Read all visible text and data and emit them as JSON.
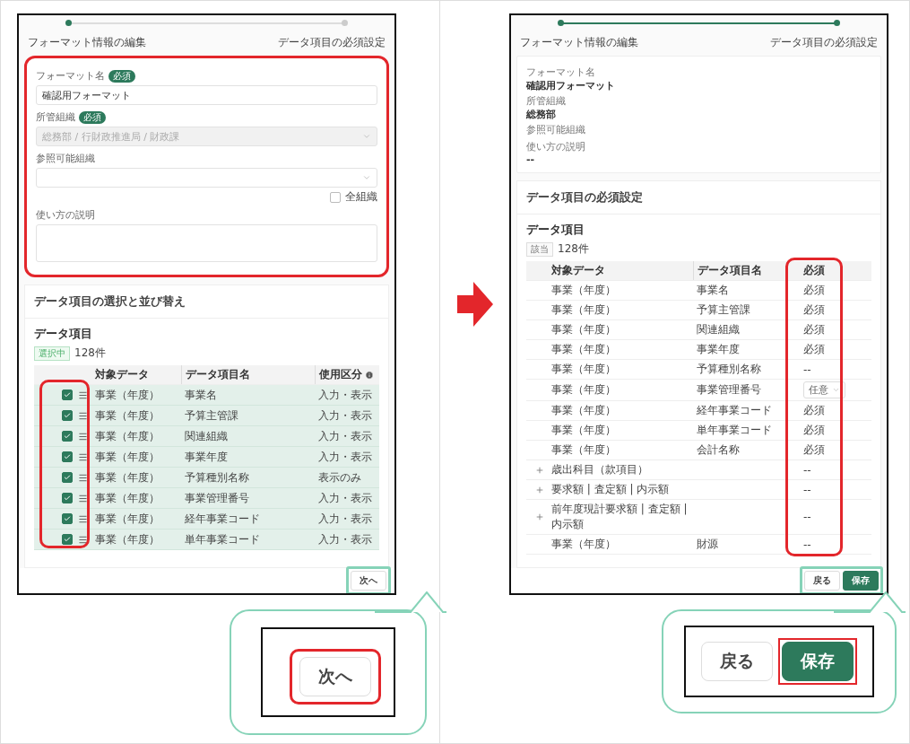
{
  "left_screen": {
    "steps": [
      {
        "label": "フォーマット情報の編集",
        "reached": true
      },
      {
        "label": "データ項目の必須設定",
        "reached": false
      }
    ],
    "form": [
      {
        "kind": "text",
        "label": "フォーマット名",
        "badge": "必須",
        "value": "確認用フォーマット"
      },
      {
        "kind": "select",
        "label": "所管組織",
        "badge": "必須",
        "value": "総務部 / 行財政推進局 / 財政課",
        "disabled": true
      },
      {
        "kind": "select",
        "label": "参照可能組織",
        "disabled": false,
        "option": {
          "label": "全組織",
          "checked": false
        }
      },
      {
        "kind": "textarea",
        "label": "使い方の説明"
      }
    ],
    "section_title": "データ項目の選択と並び替え",
    "list_title": "データ項目",
    "badge": "選択中",
    "count": "128件",
    "columns": [
      "対象データ",
      "データ項目名",
      "使用区分"
    ],
    "rows": [
      {
        "checked": true,
        "target": "事業（年度）",
        "item": "事業名",
        "usage": "入力・表示"
      },
      {
        "checked": true,
        "target": "事業（年度）",
        "item": "予算主管課",
        "usage": "入力・表示"
      },
      {
        "checked": true,
        "target": "事業（年度）",
        "item": "関連組織",
        "usage": "入力・表示"
      },
      {
        "checked": true,
        "target": "事業（年度）",
        "item": "事業年度",
        "usage": "入力・表示"
      },
      {
        "checked": true,
        "target": "事業（年度）",
        "item": "予算種別名称",
        "usage": "表示のみ"
      },
      {
        "checked": true,
        "target": "事業（年度）",
        "item": "事業管理番号",
        "usage": "入力・表示"
      },
      {
        "checked": true,
        "target": "事業（年度）",
        "item": "経年事業コード",
        "usage": "入力・表示"
      },
      {
        "checked": true,
        "target": "事業（年度）",
        "item": "単年事業コード",
        "usage": "入力・表示"
      }
    ],
    "buttons": [
      {
        "label": "次へ",
        "kind": "secondary"
      }
    ]
  },
  "left_callout": {
    "buttons": [
      {
        "label": "次へ",
        "kind": "secondary"
      }
    ]
  },
  "right_screen": {
    "steps": [
      {
        "label": "フォーマット情報の編集",
        "reached": true
      },
      {
        "label": "データ項目の必須設定",
        "reached": true
      }
    ],
    "summary": [
      {
        "label": "フォーマット名",
        "value": "確認用フォーマット"
      },
      {
        "label": "所管組織",
        "value": "総務部"
      },
      {
        "label": "参照可能組織"
      },
      {
        "label": "使い方の説明",
        "value": "--"
      }
    ],
    "section_title": "データ項目の必須設定",
    "list_title": "データ項目",
    "badge": "該当",
    "count": "128件",
    "columns": [
      "対象データ",
      "データ項目名",
      "必須"
    ],
    "rows": [
      {
        "kind": "text",
        "target": "事業（年度）",
        "item": "事業名",
        "required": "必須"
      },
      {
        "kind": "text",
        "target": "事業（年度）",
        "item": "予算主管課",
        "required": "必須"
      },
      {
        "kind": "text",
        "target": "事業（年度）",
        "item": "関連組織",
        "required": "必須"
      },
      {
        "kind": "text",
        "target": "事業（年度）",
        "item": "事業年度",
        "required": "必須"
      },
      {
        "kind": "text",
        "target": "事業（年度）",
        "item": "予算種別名称",
        "required": "--"
      },
      {
        "kind": "select",
        "target": "事業（年度）",
        "item": "事業管理番号",
        "required": "任意"
      },
      {
        "kind": "text",
        "target": "事業（年度）",
        "item": "経年事業コード",
        "required": "必須"
      },
      {
        "kind": "text",
        "target": "事業（年度）",
        "item": "単年事業コード",
        "required": "必須"
      },
      {
        "kind": "text",
        "target": "事業（年度）",
        "item": "会計名称",
        "required": "必須"
      },
      {
        "kind": "group",
        "target": "歳出科目（款項目）",
        "required": "--"
      },
      {
        "kind": "group",
        "target": "要求額 | 査定額 | 内示額",
        "required": "--"
      },
      {
        "kind": "group",
        "target": "前年度現計要求額 | 査定額 | 内示額",
        "required": "--"
      },
      {
        "kind": "text",
        "target": "事業（年度）",
        "item": "財源",
        "required": "--"
      }
    ],
    "buttons": [
      {
        "label": "戻る",
        "kind": "secondary"
      },
      {
        "label": "保存",
        "kind": "primary"
      }
    ]
  },
  "right_callout": {
    "buttons": [
      {
        "label": "戻る",
        "kind": "secondary"
      },
      {
        "label": "保存",
        "kind": "primary"
      }
    ]
  }
}
